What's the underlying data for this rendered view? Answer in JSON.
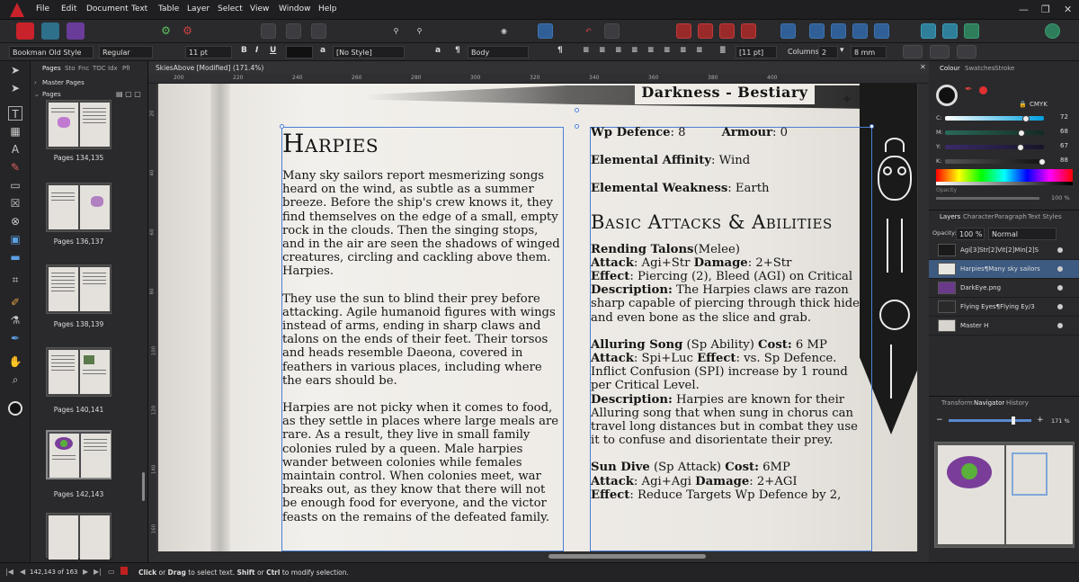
{
  "menu": [
    "File",
    "Edit",
    "Document",
    "Text",
    "Table",
    "Layer",
    "Select",
    "View",
    "Window",
    "Help"
  ],
  "context": {
    "font": "Bookman Old Style",
    "style": "Regular",
    "size": "11 pt",
    "char_style": "[No Style]",
    "para_style": "Body",
    "leading": "[11 pt]",
    "columns_label": "Columns:",
    "columns": "2",
    "gutter": "8 mm"
  },
  "pages_panel": {
    "tabs": [
      "Pages",
      "Sto",
      "Fnc",
      "TOC",
      "Idx",
      "PfI"
    ],
    "master_label": "Master Pages",
    "pages_label": "Pages",
    "thumbs": [
      "Pages 134,135",
      "Pages 136,137",
      "Pages 138,139",
      "Pages 140,141",
      "Pages 142,143",
      ""
    ]
  },
  "doc": {
    "title": "SkiesAbove [Modified] (171.4%)",
    "ruler_h": [
      "180",
      "200",
      "220",
      "240",
      "260",
      "280",
      "300",
      "320",
      "340",
      "360",
      "380",
      "400"
    ],
    "ruler_v": [
      "20",
      "40",
      "60",
      "80",
      "100",
      "120",
      "140",
      "160",
      "180",
      "200",
      "220",
      "240"
    ],
    "header": "Darkness - Bestiary",
    "left": {
      "heading": "Harpies",
      "paragraphs": [
        "Many sky sailors report mesmerizing songs heard on the wind, as subtle as a summer breeze. Before the ship's crew knows it, they find themselves on the edge of a small, empty rock in the clouds. Then the singing stops, and in the air are seen the shadows of winged creatures, circling and cackling above them. Harpies.",
        "They use the sun to blind their prey before attacking. Agile humanoid figures with wings instead of arms, ending in sharp claws and talons on the ends of their feet. Their torsos and heads resemble Daeona, covered in feathers in various places, including where the ears should be.",
        "Harpies are not picky when it comes to food, as they settle in places where large meals are rare. As a result, they live in small family colonies ruled by a queen. Male harpies wander between colonies while females maintain control. When colonies meet, war breaks out, as they know that there will not be enough food for everyone, and the victor feasts on the remains of the defeated family."
      ]
    },
    "right": {
      "wp_label": "Wp Defence",
      "wp_value": ": 8",
      "armour_label": "Armour",
      "armour_value": ": 0",
      "aff_label": "Elemental Affinity",
      "aff_value": ": Wind",
      "weak_label": "Elemental Weakness",
      "weak_value": ": Earth",
      "heading": "Basic Attacks & Abilities",
      "talons_name": "Rending Talons",
      "talons_type": "(Melee)",
      "attack_label": "Attack",
      "talons_attack": ": Agi+Str ",
      "damage_label": "Damage",
      "talons_damage": ": 2+Str",
      "effect_label": "Effect",
      "talons_effect": ": Piercing (2), Bleed (AGI) on Critical",
      "desc_label": "Description:",
      "talons_desc": " The Harpies claws are razon sharp capable of piercing through thick hide and even bone as the slice and grab.",
      "song_name": "Alluring Song",
      "song_type": " (Sp Ability) ",
      "cost_label": "Cost:",
      "song_cost": " 6 MP",
      "song_attack": ": Spi+Luc ",
      "song_effect": ": vs. Sp Defence. Inflict Confusion (SPI) increase by 1 round per Critical Level.",
      "song_desc": " Harpies are known for their Alluring song that when sung in chorus can travel long distances but in combat they use it to confuse and disorientate their prey.",
      "dive_name": "Sun Dive",
      "dive_type": " (Sp Attack) ",
      "dive_cost": " 6MP",
      "dive_attack": ": Agi+Agi ",
      "dive_damage": ": 2+AGI",
      "dive_effect": ": Reduce Targets Wp Defence by 2,"
    }
  },
  "right_panel": {
    "colour_tabs": [
      "Colour",
      "Swatches",
      "Stroke"
    ],
    "model": "CMYK",
    "c_label": "C:",
    "c": "72",
    "m_label": "M:",
    "m": "68",
    "y_label": "Y:",
    "y": "67",
    "k_label": "K:",
    "k": "88",
    "opacity_label": "Opacity",
    "opacity_value": "100 %",
    "layer_tabs": [
      "Layers",
      "Character",
      "Paragraph",
      "Text Styles"
    ],
    "layers_opacity_label": "Opacity:",
    "layers_opacity": "100 %",
    "blend": "Normal",
    "layers": [
      "Agi[3]Str[2]Vit[2]Min[2]S",
      "Harpies¶Many sky sailors",
      "DarkEye.png",
      "Flying Eyes¶Flying Ey/3",
      "Master H"
    ],
    "nav_tabs": [
      "Transform",
      "Navigator",
      "History"
    ],
    "zoom": "171 %"
  },
  "status": {
    "page_info": "142,143 of 163",
    "hint_click": "Click",
    "hint_or": " or ",
    "hint_drag": "Drag",
    "hint_mid": " to select text. ",
    "hint_shift": "Shift",
    "hint_or2": " or ",
    "hint_ctrl": "Ctrl",
    "hint_end": " to modify selection."
  },
  "colors": {
    "accent": "#4a7fd6",
    "app_red": "#c9222a",
    "selected_layer": "#3d5a80"
  }
}
